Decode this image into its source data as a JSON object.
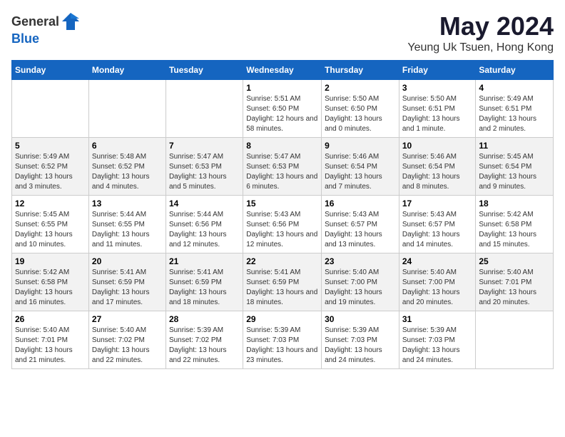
{
  "header": {
    "logo_general": "General",
    "logo_blue": "Blue",
    "month_year": "May 2024",
    "location": "Yeung Uk Tsuen, Hong Kong"
  },
  "weekdays": [
    "Sunday",
    "Monday",
    "Tuesday",
    "Wednesday",
    "Thursday",
    "Friday",
    "Saturday"
  ],
  "weeks": [
    [
      {
        "day": "",
        "sunrise": "",
        "sunset": "",
        "daylight": ""
      },
      {
        "day": "",
        "sunrise": "",
        "sunset": "",
        "daylight": ""
      },
      {
        "day": "",
        "sunrise": "",
        "sunset": "",
        "daylight": ""
      },
      {
        "day": "1",
        "sunrise": "Sunrise: 5:51 AM",
        "sunset": "Sunset: 6:50 PM",
        "daylight": "Daylight: 12 hours and 58 minutes."
      },
      {
        "day": "2",
        "sunrise": "Sunrise: 5:50 AM",
        "sunset": "Sunset: 6:50 PM",
        "daylight": "Daylight: 13 hours and 0 minutes."
      },
      {
        "day": "3",
        "sunrise": "Sunrise: 5:50 AM",
        "sunset": "Sunset: 6:51 PM",
        "daylight": "Daylight: 13 hours and 1 minute."
      },
      {
        "day": "4",
        "sunrise": "Sunrise: 5:49 AM",
        "sunset": "Sunset: 6:51 PM",
        "daylight": "Daylight: 13 hours and 2 minutes."
      }
    ],
    [
      {
        "day": "5",
        "sunrise": "Sunrise: 5:49 AM",
        "sunset": "Sunset: 6:52 PM",
        "daylight": "Daylight: 13 hours and 3 minutes."
      },
      {
        "day": "6",
        "sunrise": "Sunrise: 5:48 AM",
        "sunset": "Sunset: 6:52 PM",
        "daylight": "Daylight: 13 hours and 4 minutes."
      },
      {
        "day": "7",
        "sunrise": "Sunrise: 5:47 AM",
        "sunset": "Sunset: 6:53 PM",
        "daylight": "Daylight: 13 hours and 5 minutes."
      },
      {
        "day": "8",
        "sunrise": "Sunrise: 5:47 AM",
        "sunset": "Sunset: 6:53 PM",
        "daylight": "Daylight: 13 hours and 6 minutes."
      },
      {
        "day": "9",
        "sunrise": "Sunrise: 5:46 AM",
        "sunset": "Sunset: 6:54 PM",
        "daylight": "Daylight: 13 hours and 7 minutes."
      },
      {
        "day": "10",
        "sunrise": "Sunrise: 5:46 AM",
        "sunset": "Sunset: 6:54 PM",
        "daylight": "Daylight: 13 hours and 8 minutes."
      },
      {
        "day": "11",
        "sunrise": "Sunrise: 5:45 AM",
        "sunset": "Sunset: 6:54 PM",
        "daylight": "Daylight: 13 hours and 9 minutes."
      }
    ],
    [
      {
        "day": "12",
        "sunrise": "Sunrise: 5:45 AM",
        "sunset": "Sunset: 6:55 PM",
        "daylight": "Daylight: 13 hours and 10 minutes."
      },
      {
        "day": "13",
        "sunrise": "Sunrise: 5:44 AM",
        "sunset": "Sunset: 6:55 PM",
        "daylight": "Daylight: 13 hours and 11 minutes."
      },
      {
        "day": "14",
        "sunrise": "Sunrise: 5:44 AM",
        "sunset": "Sunset: 6:56 PM",
        "daylight": "Daylight: 13 hours and 12 minutes."
      },
      {
        "day": "15",
        "sunrise": "Sunrise: 5:43 AM",
        "sunset": "Sunset: 6:56 PM",
        "daylight": "Daylight: 13 hours and 12 minutes."
      },
      {
        "day": "16",
        "sunrise": "Sunrise: 5:43 AM",
        "sunset": "Sunset: 6:57 PM",
        "daylight": "Daylight: 13 hours and 13 minutes."
      },
      {
        "day": "17",
        "sunrise": "Sunrise: 5:43 AM",
        "sunset": "Sunset: 6:57 PM",
        "daylight": "Daylight: 13 hours and 14 minutes."
      },
      {
        "day": "18",
        "sunrise": "Sunrise: 5:42 AM",
        "sunset": "Sunset: 6:58 PM",
        "daylight": "Daylight: 13 hours and 15 minutes."
      }
    ],
    [
      {
        "day": "19",
        "sunrise": "Sunrise: 5:42 AM",
        "sunset": "Sunset: 6:58 PM",
        "daylight": "Daylight: 13 hours and 16 minutes."
      },
      {
        "day": "20",
        "sunrise": "Sunrise: 5:41 AM",
        "sunset": "Sunset: 6:59 PM",
        "daylight": "Daylight: 13 hours and 17 minutes."
      },
      {
        "day": "21",
        "sunrise": "Sunrise: 5:41 AM",
        "sunset": "Sunset: 6:59 PM",
        "daylight": "Daylight: 13 hours and 18 minutes."
      },
      {
        "day": "22",
        "sunrise": "Sunrise: 5:41 AM",
        "sunset": "Sunset: 6:59 PM",
        "daylight": "Daylight: 13 hours and 18 minutes."
      },
      {
        "day": "23",
        "sunrise": "Sunrise: 5:40 AM",
        "sunset": "Sunset: 7:00 PM",
        "daylight": "Daylight: 13 hours and 19 minutes."
      },
      {
        "day": "24",
        "sunrise": "Sunrise: 5:40 AM",
        "sunset": "Sunset: 7:00 PM",
        "daylight": "Daylight: 13 hours and 20 minutes."
      },
      {
        "day": "25",
        "sunrise": "Sunrise: 5:40 AM",
        "sunset": "Sunset: 7:01 PM",
        "daylight": "Daylight: 13 hours and 20 minutes."
      }
    ],
    [
      {
        "day": "26",
        "sunrise": "Sunrise: 5:40 AM",
        "sunset": "Sunset: 7:01 PM",
        "daylight": "Daylight: 13 hours and 21 minutes."
      },
      {
        "day": "27",
        "sunrise": "Sunrise: 5:40 AM",
        "sunset": "Sunset: 7:02 PM",
        "daylight": "Daylight: 13 hours and 22 minutes."
      },
      {
        "day": "28",
        "sunrise": "Sunrise: 5:39 AM",
        "sunset": "Sunset: 7:02 PM",
        "daylight": "Daylight: 13 hours and 22 minutes."
      },
      {
        "day": "29",
        "sunrise": "Sunrise: 5:39 AM",
        "sunset": "Sunset: 7:03 PM",
        "daylight": "Daylight: 13 hours and 23 minutes."
      },
      {
        "day": "30",
        "sunrise": "Sunrise: 5:39 AM",
        "sunset": "Sunset: 7:03 PM",
        "daylight": "Daylight: 13 hours and 24 minutes."
      },
      {
        "day": "31",
        "sunrise": "Sunrise: 5:39 AM",
        "sunset": "Sunset: 7:03 PM",
        "daylight": "Daylight: 13 hours and 24 minutes."
      },
      {
        "day": "",
        "sunrise": "",
        "sunset": "",
        "daylight": ""
      }
    ]
  ]
}
